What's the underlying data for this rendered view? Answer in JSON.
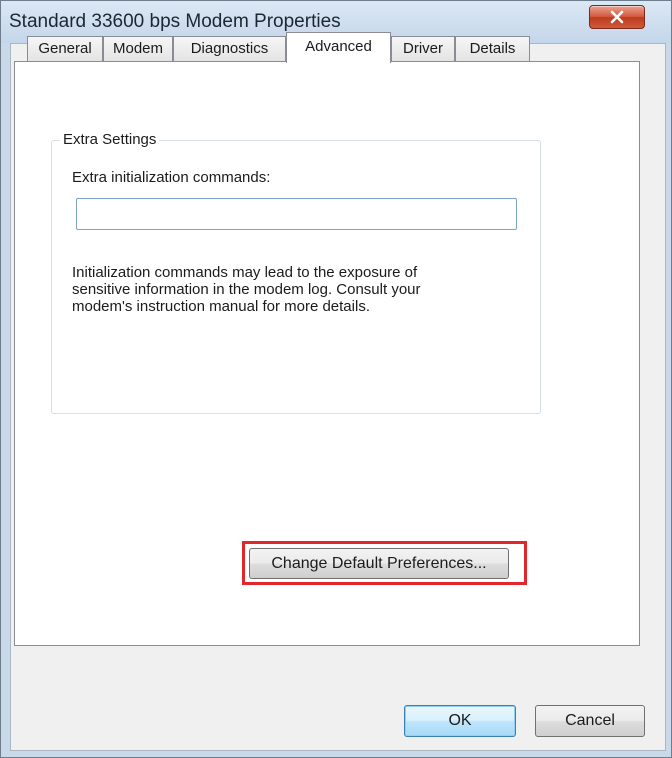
{
  "window": {
    "title": "Standard 33600 bps Modem Properties",
    "close_label": "close"
  },
  "tabs": [
    {
      "label": "General",
      "active": false
    },
    {
      "label": "Modem",
      "active": false
    },
    {
      "label": "Diagnostics",
      "active": false
    },
    {
      "label": "Advanced",
      "active": true
    },
    {
      "label": "Driver",
      "active": false
    },
    {
      "label": "Details",
      "active": false
    }
  ],
  "extra_settings": {
    "group_label": "Extra Settings",
    "field_label": "Extra initialization commands:",
    "field_value": "",
    "info_lines": [
      "Initialization commands may lead to the exposure of",
      "sensitive information in the modem log. Consult your",
      "modem's instruction manual for more details."
    ]
  },
  "buttons": {
    "change_defaults": "Change Default Preferences...",
    "ok": "OK",
    "cancel": "Cancel"
  },
  "colors": {
    "highlight": "#e3262b",
    "close_button": "#c7452a",
    "default_button_border": "#3c7fb1"
  }
}
